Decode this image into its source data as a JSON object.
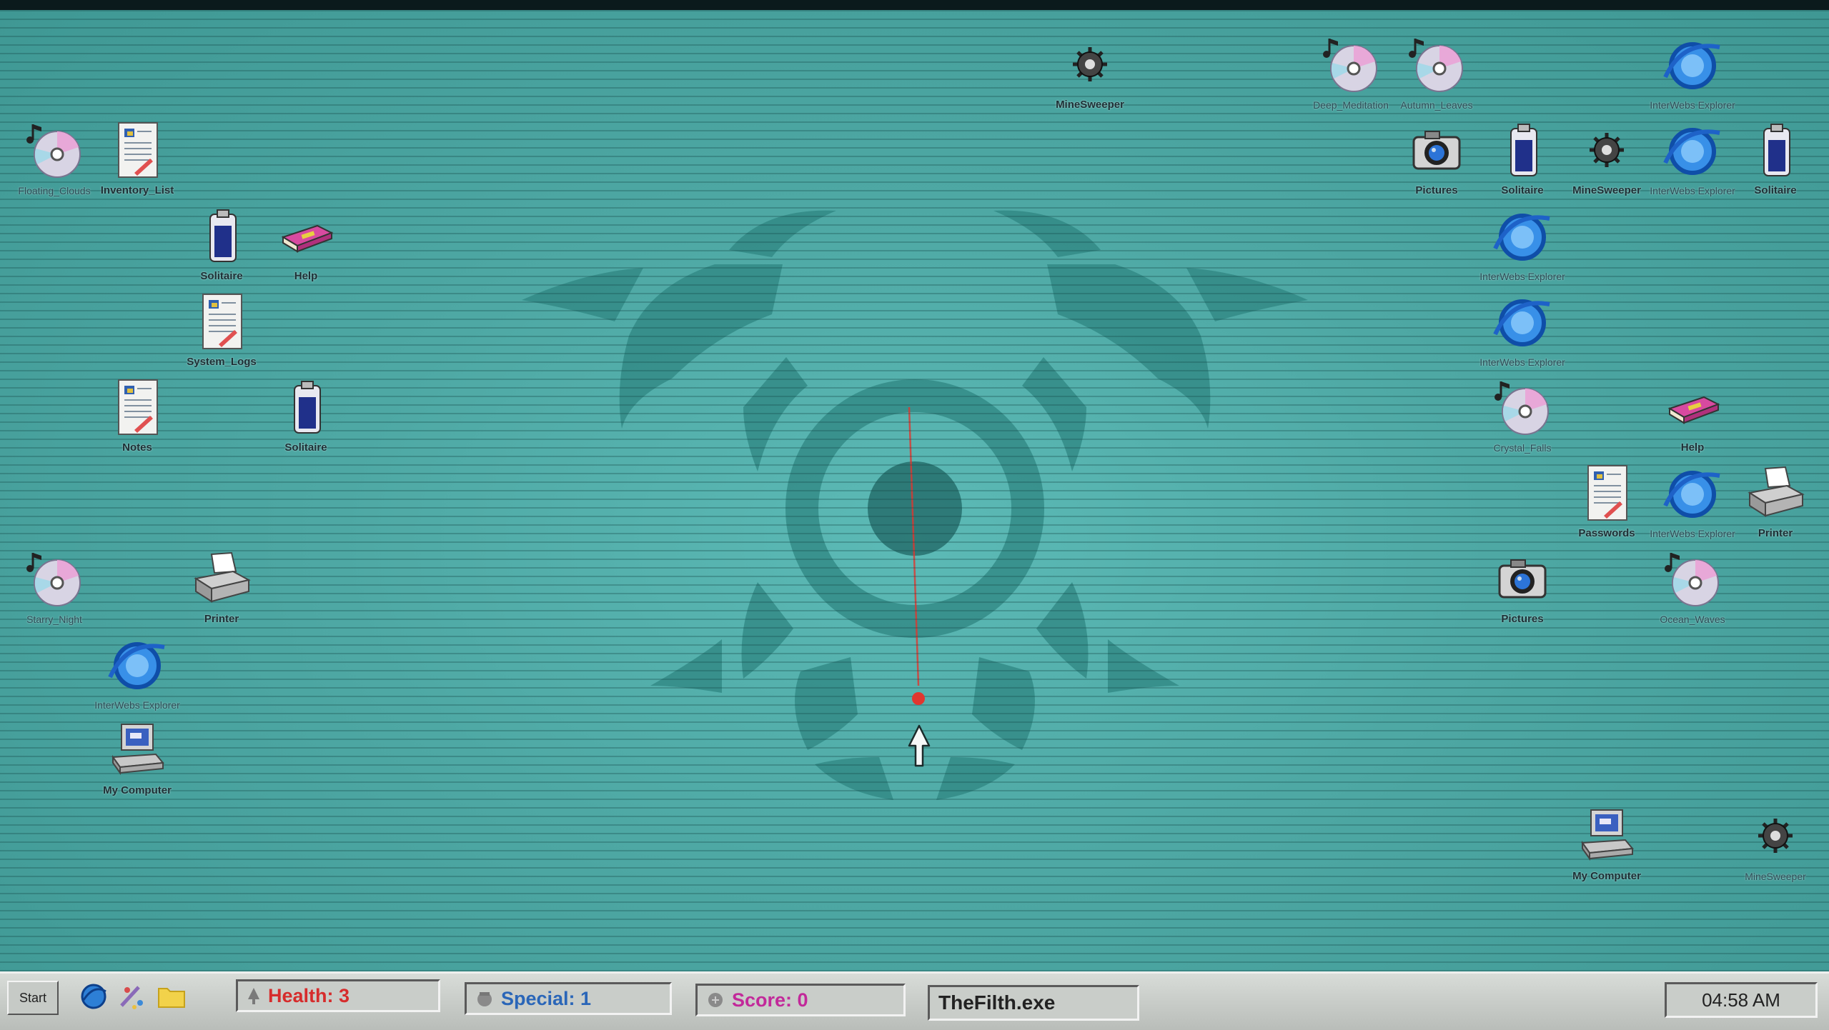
{
  "desktop": {
    "icons": [
      {
        "label": "Floating_Clouds",
        "icon": "music-cd-icon",
        "name": "desktop-icon-floating-clouds",
        "small": true
      },
      {
        "label": "Inventory_List",
        "icon": "document-icon",
        "name": "desktop-icon-inventory-list"
      },
      {
        "label": "Solitaire",
        "icon": "solitaire-icon",
        "name": "desktop-icon-solitaire-1"
      },
      {
        "label": "Help",
        "icon": "help-book-icon",
        "name": "desktop-icon-help-1"
      },
      {
        "label": "System_Logs",
        "icon": "document-icon",
        "name": "desktop-icon-system-logs"
      },
      {
        "label": "Notes",
        "icon": "document-icon",
        "name": "desktop-icon-notes"
      },
      {
        "label": "Solitaire",
        "icon": "solitaire-icon",
        "name": "desktop-icon-solitaire-2"
      },
      {
        "label": "Starry_Night",
        "icon": "music-cd-icon",
        "name": "desktop-icon-starry-night",
        "small": true
      },
      {
        "label": "Printer",
        "icon": "printer-icon",
        "name": "desktop-icon-printer-1"
      },
      {
        "label": "InterWebs Explorer",
        "icon": "browser-icon",
        "name": "desktop-icon-browser-1",
        "small": true
      },
      {
        "label": "My Computer",
        "icon": "computer-icon",
        "name": "desktop-icon-my-computer-1"
      },
      {
        "label": "MineSweeper",
        "icon": "mine-icon",
        "name": "desktop-icon-minesweeper-1"
      },
      {
        "label": "Deep_Meditation",
        "icon": "music-cd-icon",
        "name": "desktop-icon-deep-meditation",
        "small": true
      },
      {
        "label": "Autumn_Leaves",
        "icon": "music-cd-icon",
        "name": "desktop-icon-autumn-leaves",
        "small": true
      },
      {
        "label": "InterWebs Explorer",
        "icon": "browser-icon",
        "name": "desktop-icon-browser-2",
        "small": true
      },
      {
        "label": "Pictures",
        "icon": "camera-icon",
        "name": "desktop-icon-pictures-1"
      },
      {
        "label": "Solitaire",
        "icon": "solitaire-icon",
        "name": "desktop-icon-solitaire-3"
      },
      {
        "label": "MineSweeper",
        "icon": "mine-icon",
        "name": "desktop-icon-minesweeper-2"
      },
      {
        "label": "InterWebs Explorer",
        "icon": "browser-icon",
        "name": "desktop-icon-browser-3",
        "small": true
      },
      {
        "label": "Solitaire",
        "icon": "solitaire-icon",
        "name": "desktop-icon-solitaire-4"
      },
      {
        "label": "InterWebs Explorer",
        "icon": "browser-icon",
        "name": "desktop-icon-browser-4",
        "small": true
      },
      {
        "label": "InterWebs Explorer",
        "icon": "browser-icon",
        "name": "desktop-icon-browser-5",
        "small": true
      },
      {
        "label": "Crystal_Falls",
        "icon": "music-cd-icon",
        "name": "desktop-icon-crystal-falls",
        "small": true
      },
      {
        "label": "Help",
        "icon": "help-book-icon",
        "name": "desktop-icon-help-2"
      },
      {
        "label": "Passwords",
        "icon": "document-icon",
        "name": "desktop-icon-passwords"
      },
      {
        "label": "InterWebs Explorer",
        "icon": "browser-icon",
        "name": "desktop-icon-browser-6",
        "small": true
      },
      {
        "label": "Printer",
        "icon": "printer-icon",
        "name": "desktop-icon-printer-2"
      },
      {
        "label": "Pictures",
        "icon": "camera-icon",
        "name": "desktop-icon-pictures-2"
      },
      {
        "label": "Ocean_Waves",
        "icon": "music-cd-icon",
        "name": "desktop-icon-ocean-waves",
        "small": true
      },
      {
        "label": "My Computer",
        "icon": "computer-icon",
        "name": "desktop-icon-my-computer-2"
      },
      {
        "label": "MineSweeper",
        "icon": "mine-icon",
        "name": "desktop-icon-minesweeper-3",
        "small": true
      }
    ]
  },
  "taskbar": {
    "start_label": "Start",
    "quick_launch": [
      "browser-icon",
      "paint-icon",
      "folder-icon"
    ],
    "health_label": "Health: 3",
    "special_label": "Special: 1",
    "score_label": "Score: 0",
    "program_label": "TheFilth.exe",
    "clock": "04:58 AM"
  },
  "colors": {
    "health": "#d62c2c",
    "special": "#2a66b8",
    "score": "#c2299a",
    "desktop": "#4ea8a4",
    "bullet": "#e0362f"
  }
}
